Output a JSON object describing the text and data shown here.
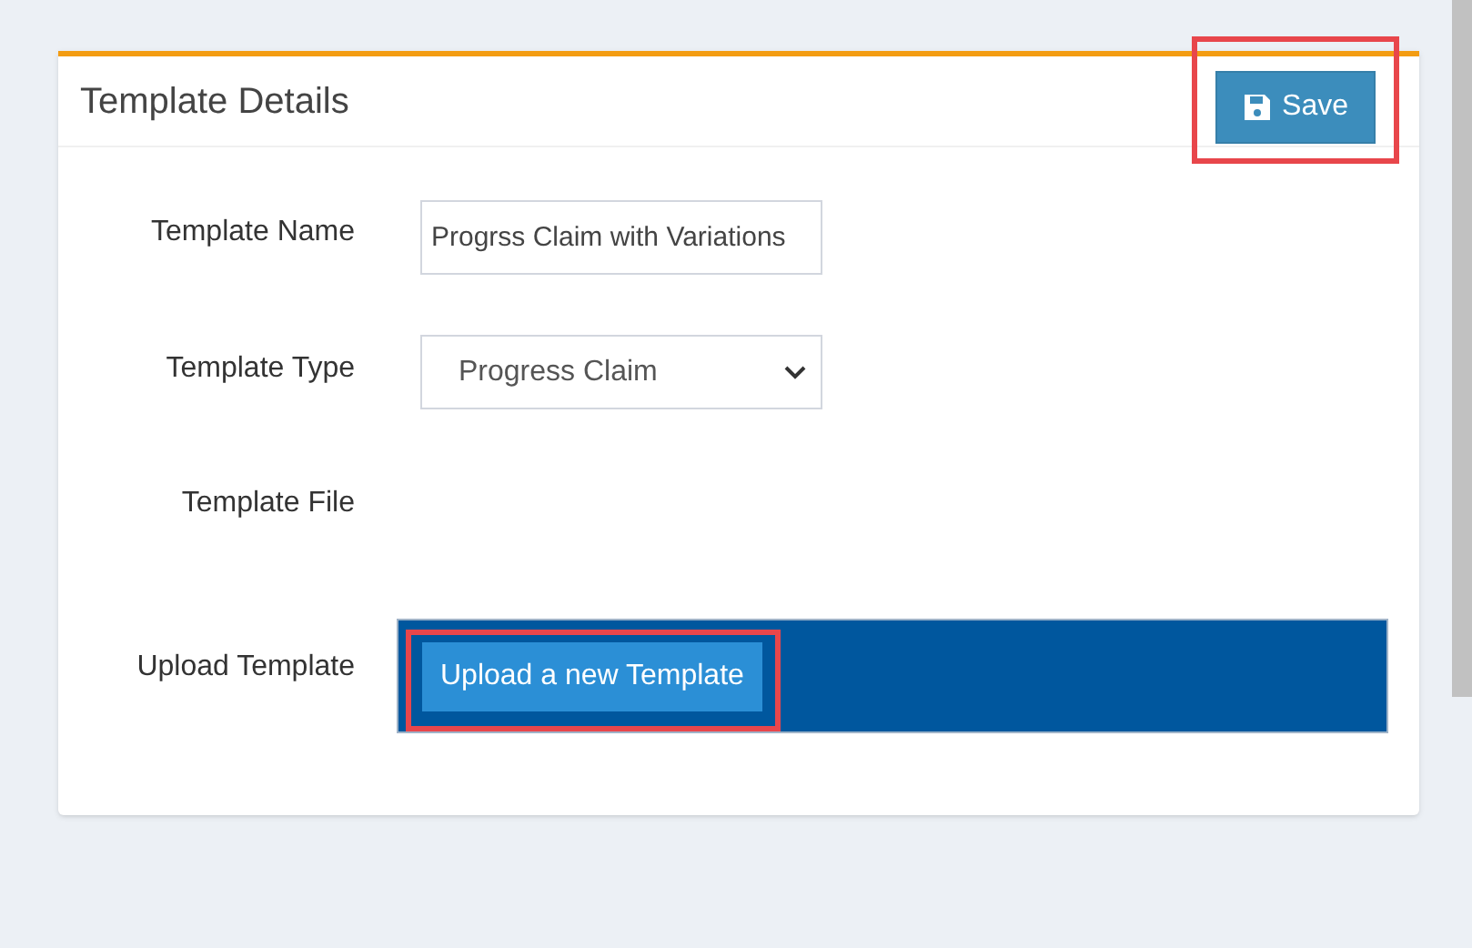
{
  "card": {
    "title": "Template Details",
    "save_button": {
      "label": "Save",
      "highlighted": true
    },
    "fields": [
      {
        "kind": "text",
        "label": "Template Name",
        "value": "Progrss Claim with Variations"
      },
      {
        "kind": "select",
        "label": "Template Type",
        "value": "Progress Claim"
      },
      {
        "kind": "empty",
        "label": "Template File"
      }
    ],
    "upload": {
      "label": "Upload Template",
      "button": {
        "label": "Upload a new Template",
        "highlighted": true
      }
    }
  }
}
